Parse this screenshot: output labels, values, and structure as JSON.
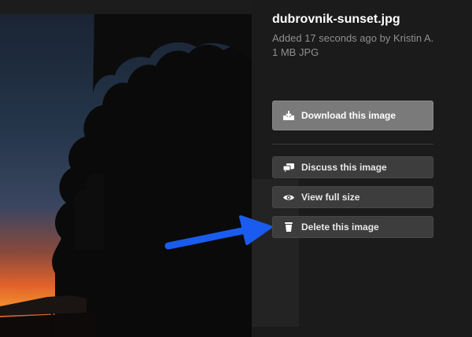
{
  "file": {
    "name": "dubrovnik-sunset.jpg",
    "meta": "Added 17 seconds ago by Kristin A.",
    "size": "1 MB JPG"
  },
  "actions": {
    "download_label": "Download this image",
    "discuss_label": "Discuss this image",
    "view_label": "View full size",
    "delete_label": "Delete this image"
  },
  "icons": {
    "download": "download-tray-icon",
    "discuss": "speech-bubbles-icon",
    "view": "eye-icon",
    "delete": "trash-can-icon",
    "annotation": "blue-arrow-icon"
  },
  "colors": {
    "panel_bg": "#141414",
    "primary_button": "#7a7a7a",
    "secondary_button": "#3d3d3d",
    "annotation_arrow": "#1a5cf0"
  }
}
